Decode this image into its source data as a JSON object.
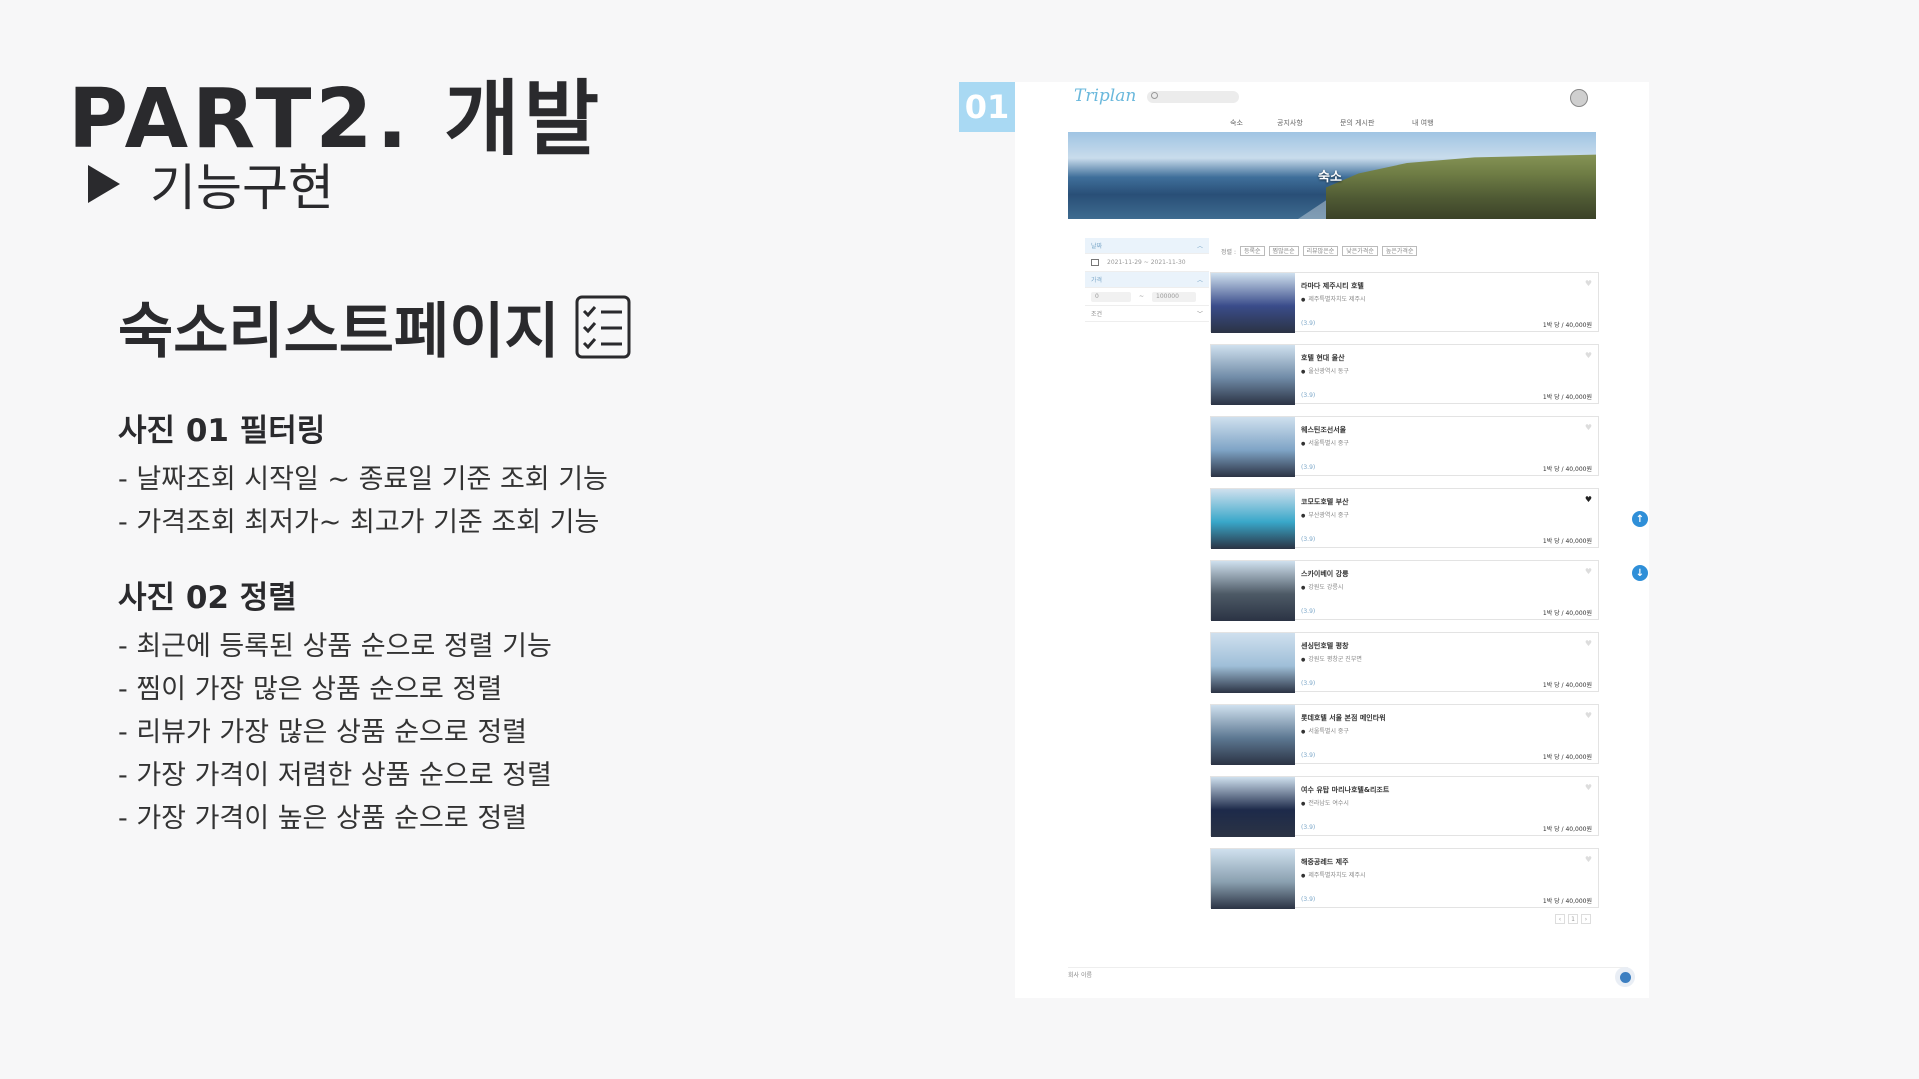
{
  "slide": {
    "title": "PART2. 개발",
    "subtitle": "기능구현",
    "heading": "숙소리스트페이지"
  },
  "sections": [
    {
      "title": "사진 01 필터링",
      "lines": [
        "- 날짜조회 시작일 ~ 종료일 기준 조회 기능",
        "- 가격조회 최저가~ 최고가 기준 조회 기능"
      ]
    },
    {
      "title": "사진 02 정렬",
      "lines": [
        "- 최근에 등록된 상품 순으로 정렬 기능",
        "- 찜이 가장 많은 상품 순으로 정렬",
        "- 리뷰가 가장 많은 상품 순으로 정렬",
        "- 가장 가격이 저렴한 상품 순으로 정렬",
        "- 가장 가격이 높은 상품 순으로 정렬"
      ]
    }
  ],
  "screenshot": {
    "badge": "01",
    "logo": "Triplan",
    "nav": [
      "숙소",
      "공지사항",
      "문의 게시판",
      "내 여행"
    ],
    "hero_caption": "숙소",
    "filter": {
      "date_label": "날짜",
      "date_range": "2021-11-29 ~ 2021-11-30",
      "price_label": "가격",
      "price_min": "0",
      "price_sep": "~",
      "price_max": "100000",
      "more_label": "조건"
    },
    "sort_label": "정렬 :",
    "sort_options": [
      "등록순",
      "찜많은순",
      "리뷰많은순",
      "낮은가격순",
      "높은가격순"
    ],
    "items": [
      {
        "name": "라마다 제주시티 호텔",
        "addr": "제주특별자치도 제주시",
        "rate": "(3.9)",
        "price": "1박 당 / 40,000원",
        "thumb": "#3a4c8a",
        "liked": false
      },
      {
        "name": "호텔 현대 울산",
        "addr": "울산광역시 동구",
        "rate": "(3.9)",
        "price": "1박 당 / 40,000원",
        "thumb": "#6f8aa6",
        "liked": false
      },
      {
        "name": "웨스틴조선서울",
        "addr": "서울특별시 중구",
        "rate": "(3.9)",
        "price": "1박 당 / 40,000원",
        "thumb": "#7fa4c6",
        "liked": false
      },
      {
        "name": "코모도호텔 부산",
        "addr": "부산광역시 중구",
        "rate": "(3.9)",
        "price": "1박 당 / 40,000원",
        "thumb": "#39a7c9",
        "liked": true
      },
      {
        "name": "스카이베이 강릉",
        "addr": "강원도 강릉시",
        "rate": "(3.9)",
        "price": "1박 당 / 40,000원",
        "thumb": "#4d5a66",
        "liked": false
      },
      {
        "name": "센싱턴호텔 평창",
        "addr": "강원도 평창군 진부면",
        "rate": "(3.9)",
        "price": "1박 당 / 40,000원",
        "thumb": "#9fbfd8",
        "liked": false
      },
      {
        "name": "롯데호텔 서울 본점 메인타워",
        "addr": "서울특별시 중구",
        "rate": "(3.9)",
        "price": "1박 당 / 40,000원",
        "thumb": "#5d7892",
        "liked": false
      },
      {
        "name": "여수 유탑 마리나호텔&리조트",
        "addr": "전라남도 여수시",
        "rate": "(3.9)",
        "price": "1박 당 / 40,000원",
        "thumb": "#1d2a4a",
        "liked": false
      },
      {
        "name": "해중공레드 제주",
        "addr": "제주특별자치도 제주시",
        "rate": "(3.9)",
        "price": "1박 당 / 40,000원",
        "thumb": "#8aa0b0",
        "liked": false
      }
    ],
    "pager": [
      "‹",
      "1",
      "›"
    ],
    "footer": "회사 이름"
  }
}
